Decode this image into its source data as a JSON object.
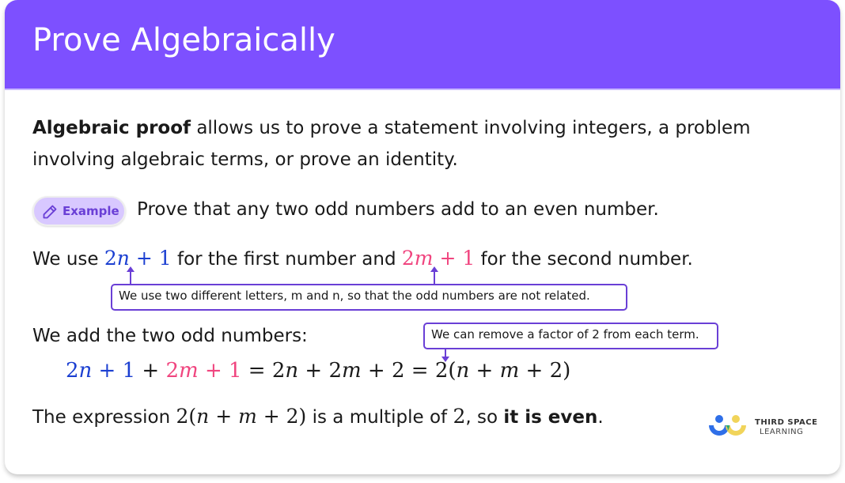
{
  "header": {
    "title": "Prove Algebraically",
    "color": "#7d50ff"
  },
  "intro": {
    "bold": "Algebraic proof",
    "rest": " allows us to prove a statement involving integers, a problem involving algebraic terms, or prove an identity."
  },
  "example": {
    "badge_label": "Example",
    "badge_icon": "pencil-icon",
    "text": "Prove that any two odd numbers add to an even number."
  },
  "step1": {
    "prefix": "We use ",
    "expr1": {
      "coef": "2",
      "var": "n",
      "rest": " + 1"
    },
    "middle": " for the first number and ",
    "expr2": {
      "coef": "2",
      "var": "m",
      "rest": " + 1"
    },
    "suffix": " for the second number.",
    "note": "We use two different letters, m and n, so that the odd numbers are not related."
  },
  "step2": {
    "text": "We add the two odd numbers:",
    "note": "We can remove a factor of 2 from each term.",
    "equation": {
      "a_coef": "2",
      "a_var": "n",
      "a_rest": " + 1",
      "plus": " + ",
      "b_coef": "2",
      "b_var": "m",
      "b_rest": " + 1",
      "eq1": " = 2",
      "eq1_var_n": "n",
      "eq1_mid": " + 2",
      "eq1_var_m": "m",
      "eq1_end": " + 2",
      "eq2": " = 2(",
      "eq2_var_n": "n",
      "eq2_mid": " + ",
      "eq2_var_m": "m",
      "eq2_end": " + 2)"
    }
  },
  "conclusion": {
    "prefix": "The expression ",
    "expr_start": "2(",
    "expr_n": "n",
    "expr_mid": " + ",
    "expr_m": "m",
    "expr_end": " + 2)",
    "middle": " is a multiple of ",
    "two": "2",
    "after": ", so ",
    "bold": "it is even",
    "end": "."
  },
  "logo": {
    "line1": "THIRD SPACE",
    "line2": "LEARNING"
  },
  "colors": {
    "accent": "#7d50ff",
    "blue": "#1b3fd1",
    "pink": "#f0457f",
    "note_border": "#6a3fd6"
  }
}
